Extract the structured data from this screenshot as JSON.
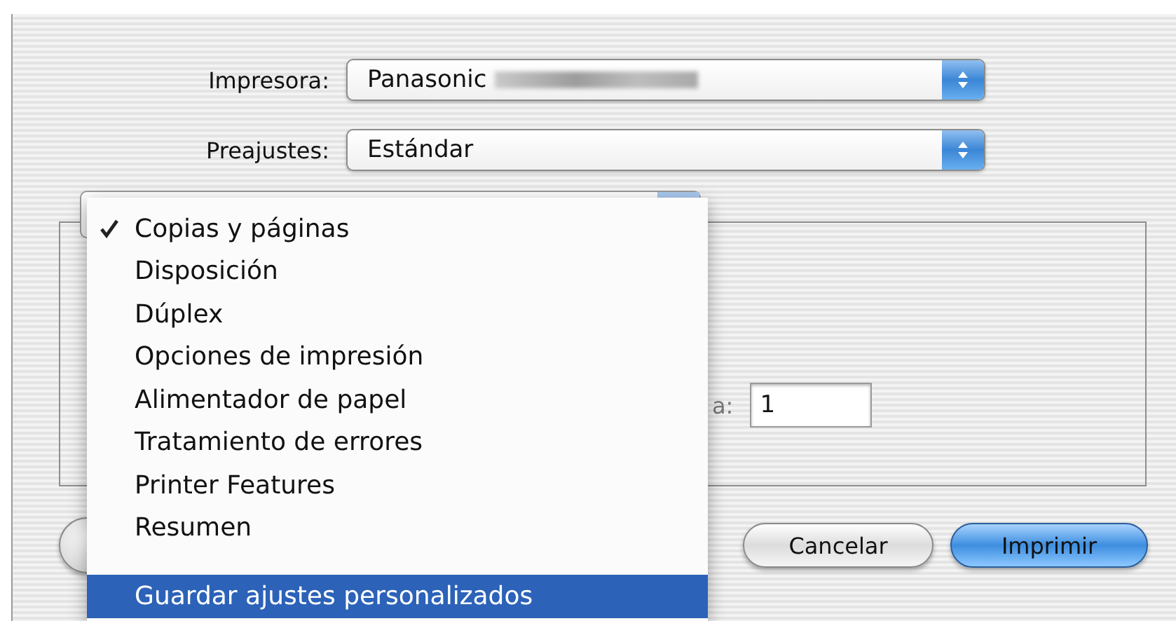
{
  "printer": {
    "label": "Impresora:",
    "value": "Panasonic",
    "redacted": true
  },
  "presets": {
    "label": "Preajustes:",
    "value": "Estándar"
  },
  "panel": {
    "to_label": "a:",
    "to": "1"
  },
  "buttons": [
    {
      "kind": "help"
    },
    {
      "kind": "normal",
      "label": "Cancelar"
    },
    {
      "kind": "default",
      "label": "Imprimir"
    }
  ],
  "menu": {
    "items": [
      {
        "kind": "item",
        "label": "Copias y páginas",
        "checked": true,
        "selected": false
      },
      {
        "kind": "item",
        "label": "Disposición",
        "checked": false,
        "selected": false
      },
      {
        "kind": "item",
        "label": "Dúplex",
        "checked": false,
        "selected": false
      },
      {
        "kind": "item",
        "label": "Opciones de impresión",
        "checked": false,
        "selected": false
      },
      {
        "kind": "item",
        "label": "Alimentador de papel",
        "checked": false,
        "selected": false
      },
      {
        "kind": "item",
        "label": "Tratamiento de errores",
        "checked": false,
        "selected": false
      },
      {
        "kind": "item",
        "label": "Printer Features",
        "checked": false,
        "selected": false
      },
      {
        "kind": "item",
        "label": "Resumen",
        "checked": false,
        "selected": false
      },
      {
        "kind": "separator"
      },
      {
        "kind": "item",
        "label": "Guardar ajustes personalizados",
        "checked": false,
        "selected": true
      }
    ]
  }
}
